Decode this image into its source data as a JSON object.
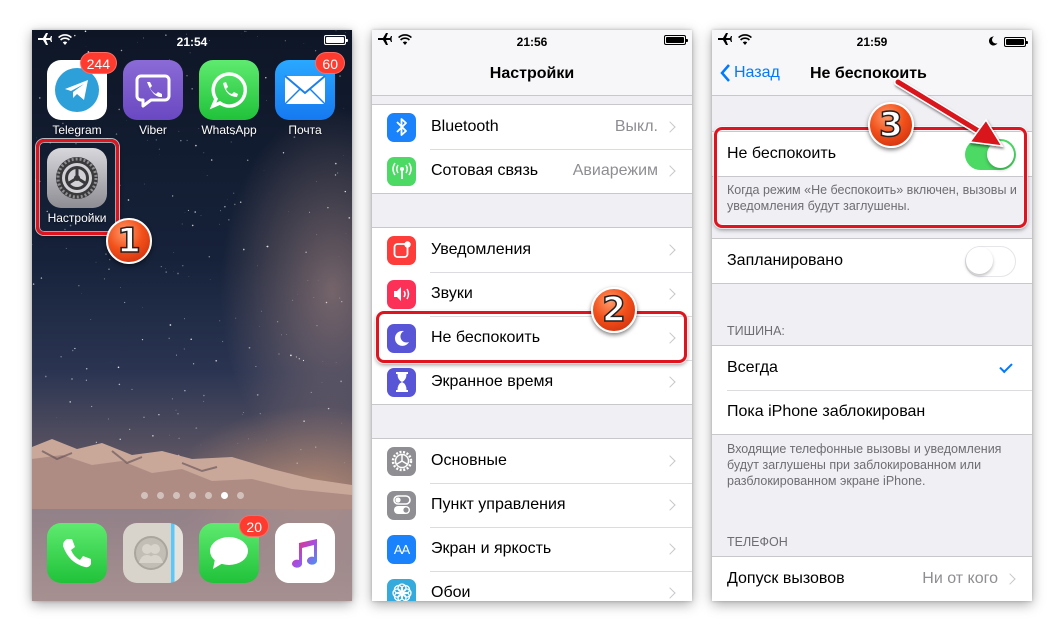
{
  "screen1": {
    "status_time": "21:54",
    "apps": [
      {
        "label": "Telegram",
        "badge": "244"
      },
      {
        "label": "Viber",
        "badge": ""
      },
      {
        "label": "WhatsApp",
        "badge": ""
      },
      {
        "label": "Почта",
        "badge": "60"
      },
      {
        "label": "Настройки",
        "badge": ""
      }
    ],
    "page_dots": {
      "count": 7,
      "active_index": 5
    },
    "dock": [
      {
        "name": "phone",
        "badge": ""
      },
      {
        "name": "contacts",
        "badge": ""
      },
      {
        "name": "messages",
        "badge": "20"
      },
      {
        "name": "music",
        "badge": ""
      }
    ],
    "step_label": "1"
  },
  "screen2": {
    "status_time": "21:56",
    "title": "Настройки",
    "groups": [
      [
        {
          "label": "Bluetooth",
          "value": "Выкл.",
          "icon": "bluetooth-icon",
          "color": "#1a82fb"
        },
        {
          "label": "Сотовая связь",
          "value": "Авиарежим",
          "icon": "cellular-icon",
          "color": "#4cd964"
        }
      ],
      [
        {
          "label": "Уведомления",
          "value": "",
          "icon": "notifications-icon",
          "color": "#fc3d39"
        },
        {
          "label": "Звуки",
          "value": "",
          "icon": "sounds-icon",
          "color": "#fc3158"
        },
        {
          "label": "Не беспокоить",
          "value": "",
          "icon": "moon-icon",
          "color": "#5856d6"
        },
        {
          "label": "Экранное время",
          "value": "",
          "icon": "hourglass-icon",
          "color": "#5856d6"
        }
      ],
      [
        {
          "label": "Основные",
          "value": "",
          "icon": "gear-icon",
          "color": "#8e8e93"
        },
        {
          "label": "Пункт управления",
          "value": "",
          "icon": "control-center-icon",
          "color": "#8e8e93"
        },
        {
          "label": "Экран и яркость",
          "value": "",
          "icon": "display-icon",
          "color": "#1a82fb"
        },
        {
          "label": "Обои",
          "value": "",
          "icon": "wallpaper-icon",
          "color": "#35aadc"
        }
      ]
    ],
    "display_icon_text": "AA",
    "step_label": "2"
  },
  "screen3": {
    "status_time": "21:59",
    "back_label": "Назад",
    "title": "Не беспокоить",
    "dnd_label": "Не беспокоить",
    "dnd_on": true,
    "dnd_footer": "Когда режим «Не беспокоить» включен, вызовы и уведомления будут заглушены.",
    "scheduled_label": "Запланировано",
    "scheduled_on": false,
    "silence_header": "ТИШИНА:",
    "silence_options": [
      {
        "label": "Всегда",
        "selected": true
      },
      {
        "label": "Пока iPhone заблокирован",
        "selected": false
      }
    ],
    "silence_footer": "Входящие телефонные вызовы и уведомления будут заглушены при заблокированном или разблокированном экране iPhone.",
    "phone_header": "ТЕЛЕФОН",
    "allow_calls_label": "Допуск вызовов",
    "allow_calls_value": "Ни от кого",
    "step_label": "3"
  },
  "colors": {
    "accent": "#007aff",
    "toggle_on": "#4cd964",
    "highlight": "#e0141e",
    "badge": "#ff3b30"
  }
}
